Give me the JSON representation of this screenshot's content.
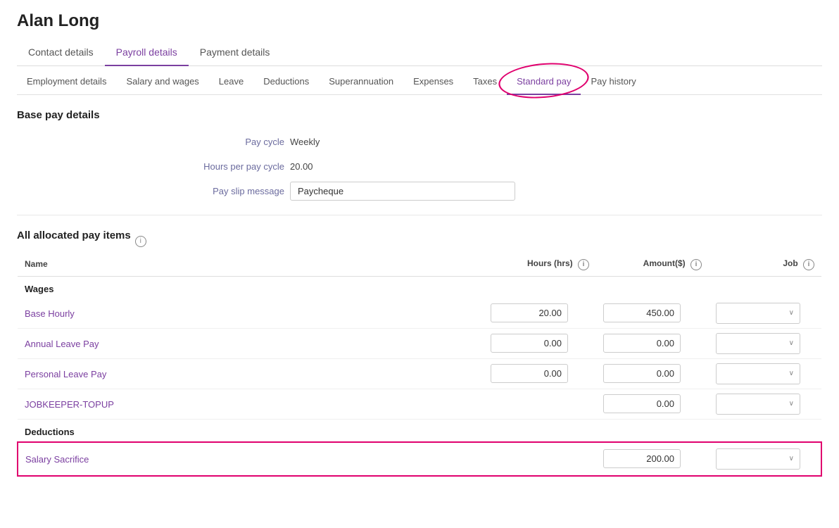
{
  "page": {
    "title": "Alan Long"
  },
  "top_tabs": [
    {
      "id": "contact",
      "label": "Contact details",
      "active": false
    },
    {
      "id": "payroll",
      "label": "Payroll details",
      "active": true
    },
    {
      "id": "payment",
      "label": "Payment details",
      "active": false
    }
  ],
  "sub_tabs": [
    {
      "id": "employment",
      "label": "Employment details",
      "active": false,
      "circled": false
    },
    {
      "id": "salary",
      "label": "Salary and wages",
      "active": false,
      "circled": false
    },
    {
      "id": "leave",
      "label": "Leave",
      "active": false,
      "circled": false
    },
    {
      "id": "deductions",
      "label": "Deductions",
      "active": false,
      "circled": false
    },
    {
      "id": "superannuation",
      "label": "Superannuation",
      "active": false,
      "circled": false
    },
    {
      "id": "expenses",
      "label": "Expenses",
      "active": false,
      "circled": false
    },
    {
      "id": "taxes",
      "label": "Taxes",
      "active": false,
      "circled": false
    },
    {
      "id": "standard_pay",
      "label": "Standard pay",
      "active": true,
      "circled": true
    },
    {
      "id": "pay_history",
      "label": "Pay history",
      "active": false,
      "circled": false
    }
  ],
  "base_pay": {
    "section_title": "Base pay details",
    "fields": [
      {
        "label": "Pay cycle",
        "value": "Weekly",
        "type": "text"
      },
      {
        "label": "Hours per pay cycle",
        "value": "20.00",
        "type": "text"
      },
      {
        "label": "Pay slip message",
        "value": "Paycheque",
        "type": "input"
      }
    ]
  },
  "pay_items": {
    "section_title": "All allocated pay items",
    "columns": {
      "name": "Name",
      "hours": "Hours (hrs)",
      "amount": "Amount($)",
      "job": "Job"
    },
    "groups": [
      {
        "group_name": "Wages",
        "items": [
          {
            "name": "Base Hourly",
            "hours": "20.00",
            "amount": "450.00"
          },
          {
            "name": "Annual Leave Pay",
            "hours": "0.00",
            "amount": "0.00"
          },
          {
            "name": "Personal Leave Pay",
            "hours": "0.00",
            "amount": "0.00"
          },
          {
            "name": "JOBKEEPER-TOPUP",
            "hours": null,
            "amount": "0.00"
          }
        ]
      },
      {
        "group_name": "Deductions",
        "items": [
          {
            "name": "Salary Sacrifice",
            "hours": null,
            "amount": "200.00",
            "highlighted": true
          }
        ]
      }
    ]
  },
  "icons": {
    "info": "i",
    "chevron_down": "∨"
  }
}
